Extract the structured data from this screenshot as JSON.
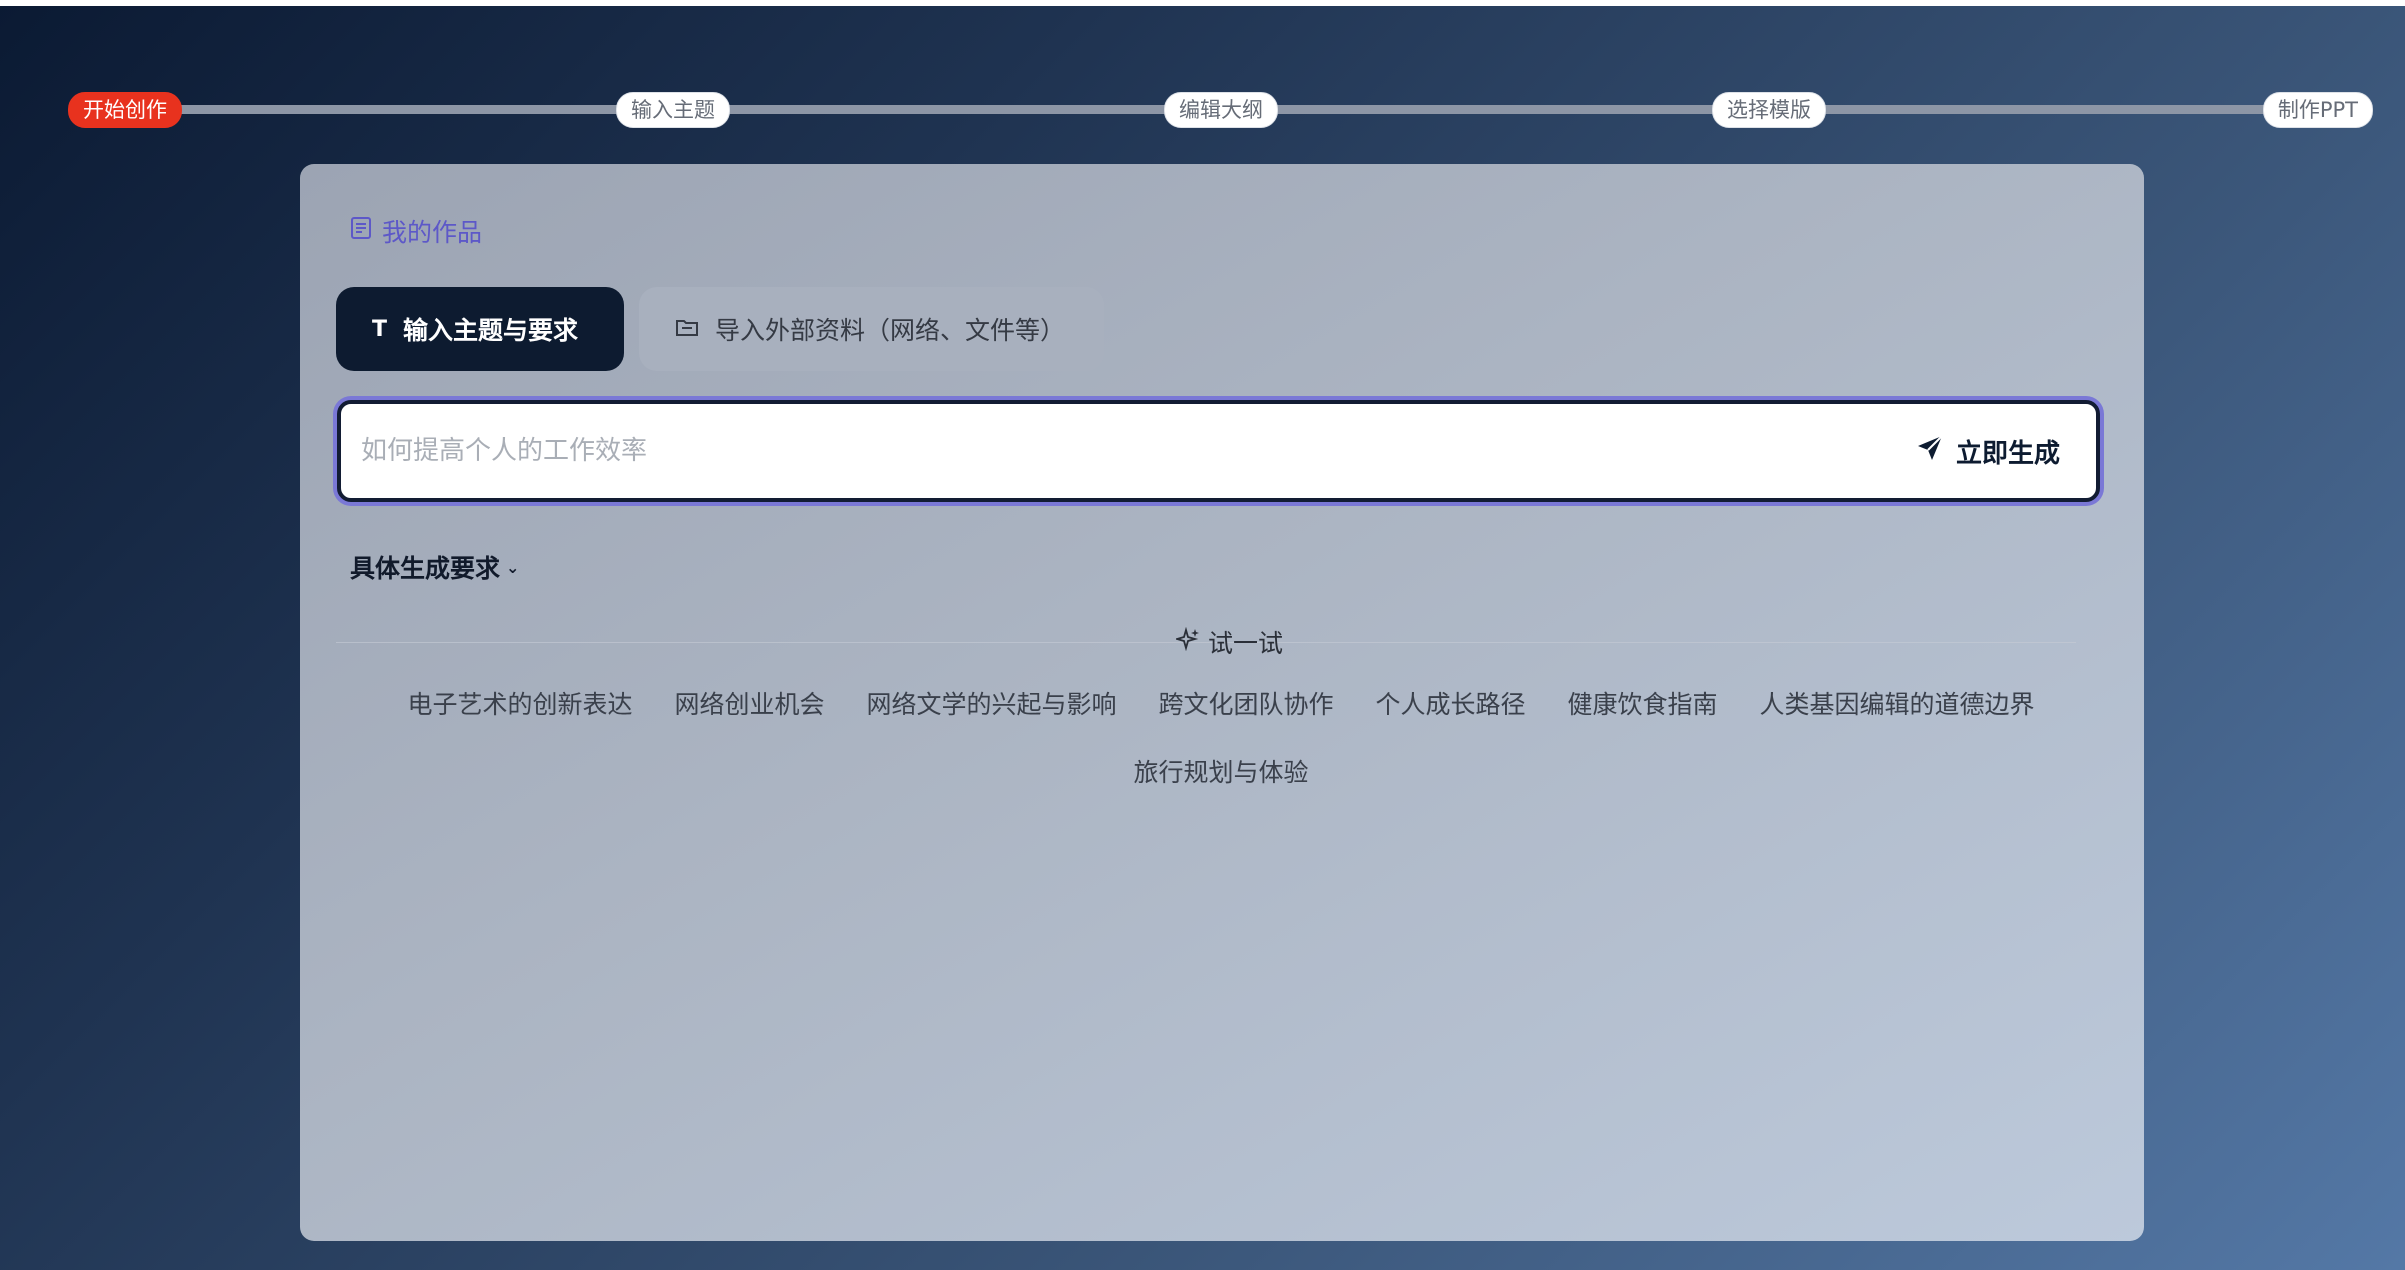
{
  "stepper": {
    "steps": [
      "开始创作",
      "输入主题",
      "编辑大纲",
      "选择模版",
      "制作PPT"
    ],
    "active_color": "#e8321e"
  },
  "panel": {
    "my_works": "我的作品",
    "tabs": [
      {
        "label": "输入主题与要求",
        "icon": "text-icon",
        "active": true
      },
      {
        "label": "导入外部资料（网络、文件等）",
        "icon": "folder-icon",
        "active": false
      }
    ],
    "search": {
      "placeholder": "如何提高个人的工作效率",
      "value": "",
      "generate_label": "立即生成"
    },
    "requirements_label": "具体生成要求",
    "try_label": "试一试",
    "suggestions": [
      "电子艺术的创新表达",
      "网络创业机会",
      "网络文学的兴起与影响",
      "跨文化团队协作",
      "个人成长路径",
      "健康饮食指南",
      "人类基因编辑的道德边界",
      "旅行规划与体验"
    ]
  },
  "colors": {
    "accent": "#5d58c8",
    "dark": "#0d1b30",
    "focus_ring": "#7a78d6"
  }
}
